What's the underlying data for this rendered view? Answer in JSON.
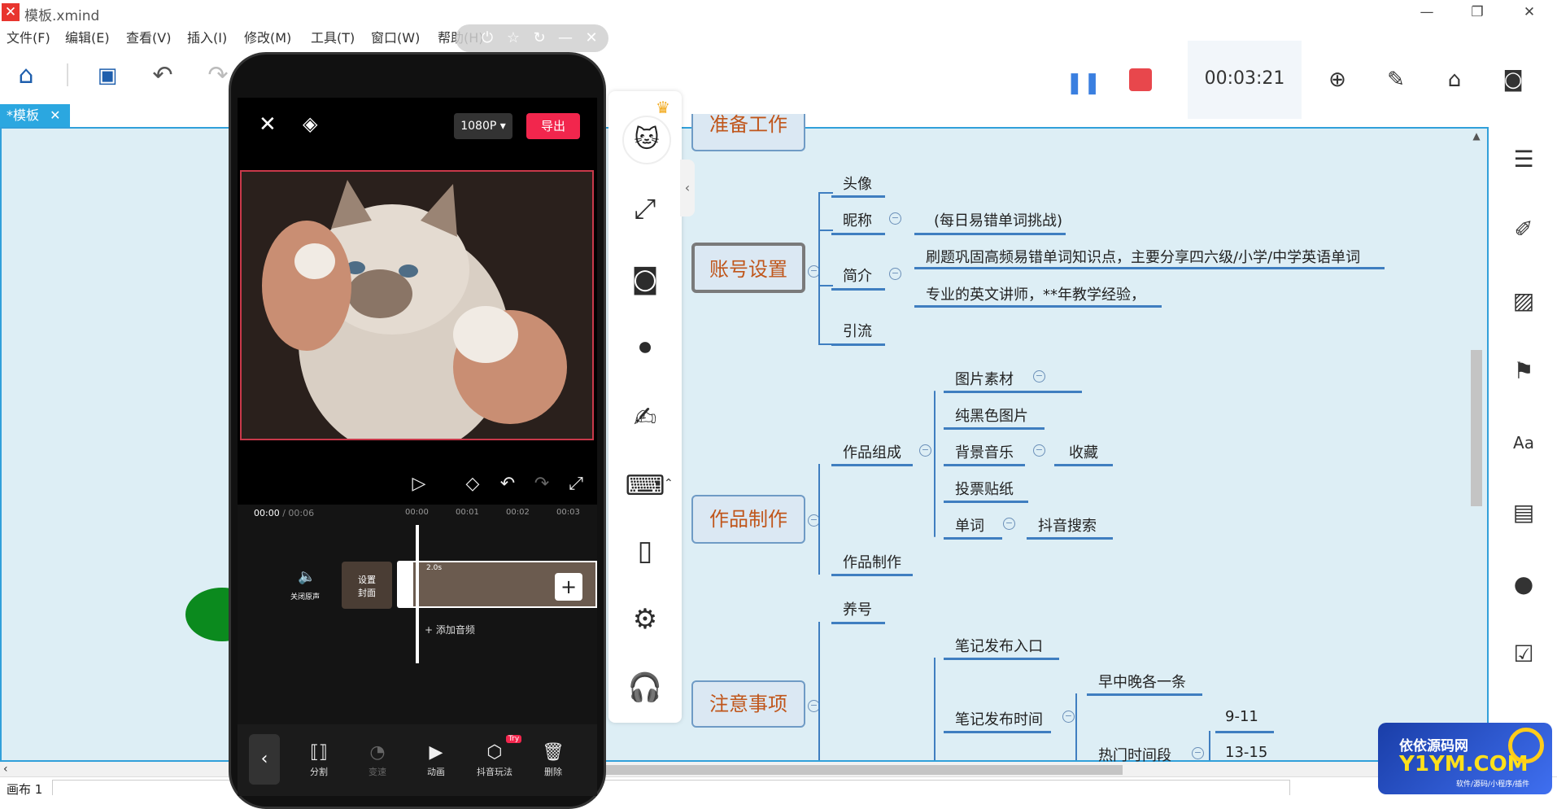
{
  "window": {
    "title": "模板.xmind",
    "tab_label": "*模板",
    "tab_close": "✕",
    "minimize": "—",
    "restore": "❐",
    "close": "✕"
  },
  "menu": [
    "文件(F)",
    "编辑(E)",
    "查看(V)",
    "插入(I)",
    "修改(M)",
    "工具(T)",
    "窗口(W)",
    "帮助(H)"
  ],
  "recorder": {
    "timer": "00:03:21"
  },
  "mindmap": {
    "top_partial": "准备工作",
    "topics": [
      "账号设置",
      "作品制作",
      "注意事项"
    ],
    "account": {
      "avatar": "头像",
      "nickname": "昵称",
      "nickname_value": "(每日易错单词挑战)",
      "intro": "简介",
      "intro_1": "刷题巩固高频易错单词知识点，主要分享四六级/小学/中学英语单词",
      "intro_2": "专业的英文讲师，**年教学经验，",
      "traffic": "引流"
    },
    "works": {
      "composition": "作品组成",
      "image_material": "图片素材",
      "black_image": "纯黑色图片",
      "bgm": "背景音乐",
      "bgm_sub": "收藏",
      "vote_sticker": "投票贴纸",
      "words": "单词",
      "words_sub": "抖音搜索",
      "making": "作品制作"
    },
    "notes": {
      "raise": "养号",
      "entry": "笔记发布入口",
      "time": "笔记发布时间",
      "daily": "早中晚各一条",
      "hot": "热门时间段",
      "t1": "9-11",
      "t2": "13-15"
    }
  },
  "phone": {
    "quality": "1080P ▾",
    "export": "导出",
    "time_current": "00:00",
    "time_total": "/ 00:06",
    "ticks": [
      "00:00",
      "00:01",
      "00:02",
      "00:03"
    ],
    "mute": "关闭原声",
    "cover_1": "设置",
    "cover_2": "封面",
    "clip_len": "2.0s",
    "add_audio": "+ 添加音频",
    "tools": [
      "分割",
      "变速",
      "动画",
      "抖音玩法",
      "删除"
    ],
    "try_badge": "Try"
  },
  "status": {
    "sheet": "画布 1"
  },
  "watermark": {
    "line1": "依依源码网",
    "line2": "Y1YM.COM",
    "line3": "软件/源码/小程序/插件"
  },
  "colors": {
    "accent": "#31a0da",
    "topic_text": "#c0561b",
    "export": "#f2264d",
    "record": "#e8474c"
  }
}
